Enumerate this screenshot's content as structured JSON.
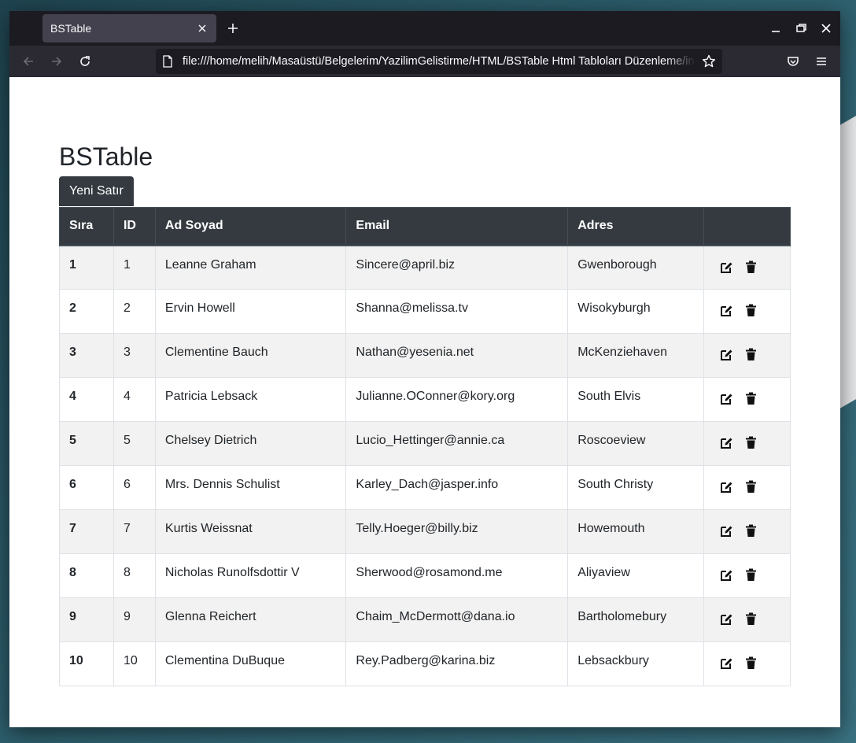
{
  "browser": {
    "tab_title": "BSTable",
    "url": "file:///home/melih/Masaüstü/Belgelerim/YazilimGelistirme/HTML/BSTable Html Tabloları Düzenleme/index.html"
  },
  "page": {
    "title": "BSTable",
    "new_row_button": "Yeni Satır"
  },
  "table": {
    "headers": [
      "Sıra",
      "ID",
      "Ad Soyad",
      "Email",
      "Adres",
      ""
    ],
    "rows": [
      {
        "sira": "1",
        "id": "1",
        "name": "Leanne Graham",
        "email": "Sincere@april.biz",
        "address": "Gwenborough"
      },
      {
        "sira": "2",
        "id": "2",
        "name": "Ervin Howell",
        "email": "Shanna@melissa.tv",
        "address": "Wisokyburgh"
      },
      {
        "sira": "3",
        "id": "3",
        "name": "Clementine Bauch",
        "email": "Nathan@yesenia.net",
        "address": "McKenziehaven"
      },
      {
        "sira": "4",
        "id": "4",
        "name": "Patricia Lebsack",
        "email": "Julianne.OConner@kory.org",
        "address": "South Elvis"
      },
      {
        "sira": "5",
        "id": "5",
        "name": "Chelsey Dietrich",
        "email": "Lucio_Hettinger@annie.ca",
        "address": "Roscoeview"
      },
      {
        "sira": "6",
        "id": "6",
        "name": "Mrs. Dennis Schulist",
        "email": "Karley_Dach@jasper.info",
        "address": "South Christy"
      },
      {
        "sira": "7",
        "id": "7",
        "name": "Kurtis Weissnat",
        "email": "Telly.Hoeger@billy.biz",
        "address": "Howemouth"
      },
      {
        "sira": "8",
        "id": "8",
        "name": "Nicholas Runolfsdottir V",
        "email": "Sherwood@rosamond.me",
        "address": "Aliyaview"
      },
      {
        "sira": "9",
        "id": "9",
        "name": "Glenna Reichert",
        "email": "Chaim_McDermott@dana.io",
        "address": "Bartholomebury"
      },
      {
        "sira": "10",
        "id": "10",
        "name": "Clementina DuBuque",
        "email": "Rey.Padberg@karina.biz",
        "address": "Lebsackbury"
      }
    ],
    "row_actions": [
      "edit-icon",
      "delete-icon"
    ]
  },
  "colors": {
    "header_bg": "#343a40",
    "stripe_bg": "#f2f2f2",
    "border": "#dee2e6",
    "browser_titlebar": "#1c1b22",
    "browser_toolbar": "#2b2a33"
  }
}
